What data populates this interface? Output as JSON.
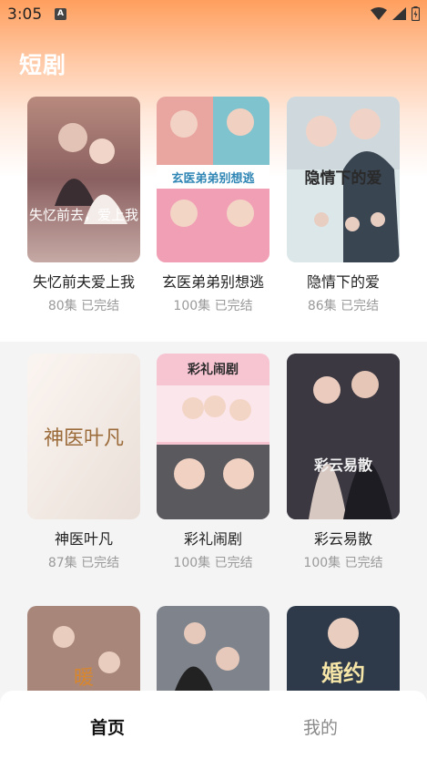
{
  "status_bar": {
    "time": "3:05"
  },
  "app": {
    "title": "短剧"
  },
  "dramas": [
    {
      "title": "失忆前夫爱上我",
      "episodes": "80集",
      "status": "已完结",
      "poster_text": "失忆前去，爱上我"
    },
    {
      "title": "玄医弟弟别想逃",
      "episodes": "100集",
      "status": "已完结",
      "poster_text": "玄医弟弟别想逃"
    },
    {
      "title": "隐情下的爱",
      "episodes": "86集",
      "status": "已完结",
      "poster_text": "隐情下的爱"
    },
    {
      "title": "神医叶凡",
      "episodes": "87集",
      "status": "已完结",
      "poster_text": "神医叶凡"
    },
    {
      "title": "彩礼闹剧",
      "episodes": "100集",
      "status": "已完结",
      "poster_text": "彩礼闹剧"
    },
    {
      "title": "彩云易散",
      "episodes": "100集",
      "status": "已完结",
      "poster_text": "彩云易散"
    },
    {
      "title": "",
      "episodes": "",
      "status": "",
      "poster_text": "暖"
    },
    {
      "title": "",
      "episodes": "",
      "status": "",
      "poster_text": ""
    },
    {
      "title": "",
      "episodes": "",
      "status": "",
      "poster_text": "婚约"
    }
  ],
  "nav": {
    "home": "首页",
    "mine": "我的"
  }
}
